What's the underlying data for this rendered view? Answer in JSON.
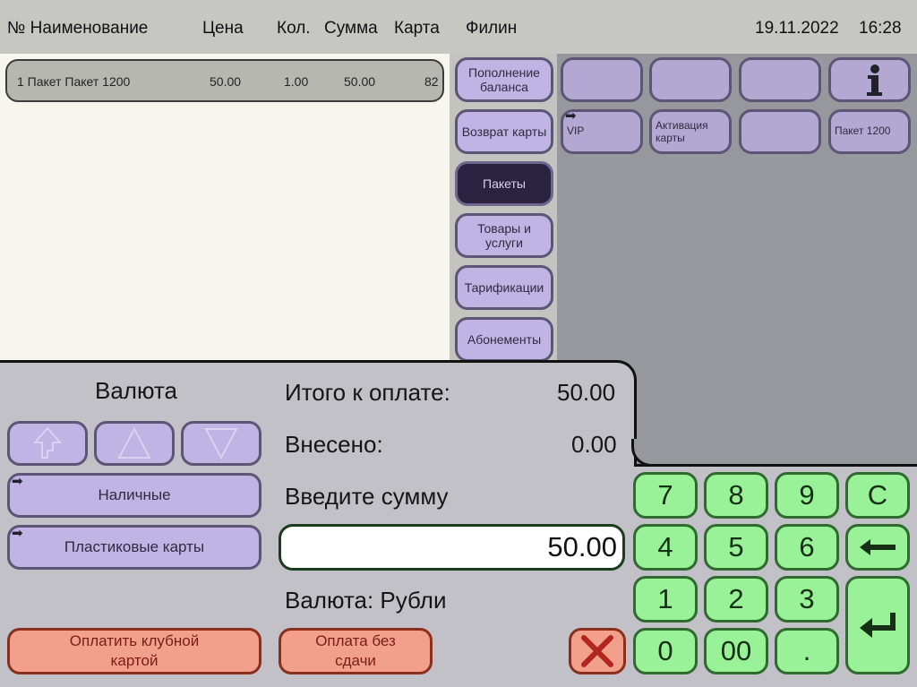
{
  "header": {
    "col_no_name": "№ Наименование",
    "col_price": "Цена",
    "col_qty": "Кол.",
    "col_sum": "Сумма",
    "col_card": "Карта",
    "operator": "Филин",
    "date": "19.11.2022",
    "time": "16:28"
  },
  "order": {
    "rows": [
      {
        "name": "1 Пакет Пакет 1200",
        "price": "50.00",
        "qty": "1.00",
        "sum": "50.00",
        "card": "82"
      }
    ]
  },
  "categories": [
    {
      "label": "Пополнение баланса"
    },
    {
      "label": "Возврат карты"
    },
    {
      "label": "Пакеты"
    },
    {
      "label": "Товары и услуги"
    },
    {
      "label": "Тарификации"
    },
    {
      "label": "Абонементы"
    }
  ],
  "items": [
    {
      "label": ""
    },
    {
      "label": ""
    },
    {
      "label": ""
    },
    {
      "label": "",
      "icon": "info-icon"
    },
    {
      "label": "VIP"
    },
    {
      "label": "Активация карты"
    },
    {
      "label": ""
    },
    {
      "label": "Пакет 1200"
    }
  ],
  "payment": {
    "currency_title": "Валюта",
    "total_label": "Итого к оплате:",
    "total_value": "50.00",
    "paid_label": "Внесено:",
    "paid_value": "0.00",
    "enter_label": "Введите сумму",
    "amount_value": "50.00",
    "currency_line": "Валюта: Рубли",
    "methods": [
      {
        "label": "Наличные"
      },
      {
        "label": "Пластиковые карты"
      }
    ],
    "club_card_label": "Оплатить клубной картой",
    "no_change_label": "Оплата без сдачи"
  },
  "keypad": {
    "keys": [
      "7",
      "8",
      "9",
      "C",
      "4",
      "5",
      "6",
      "1",
      "2",
      "3",
      "0",
      "00",
      "."
    ]
  },
  "colors": {
    "purple_button": "#c0b4e4",
    "active_category": "#2b2140",
    "green_key": "#99f198",
    "red_button": "#f2a08c"
  }
}
